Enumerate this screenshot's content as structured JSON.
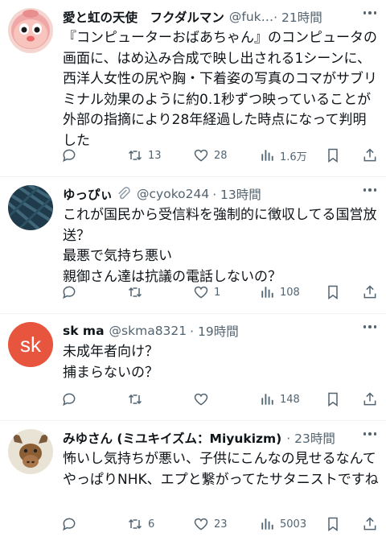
{
  "tweets": [
    {
      "name": "愛と虹の天使　フクダルマン",
      "handle": "@fuk…",
      "time": "· 21時間",
      "text": "『コンピューターおばあちゃん』のコンピュータの画面に、はめ込み合成で映し出される1シーンに、西洋人女性の尻や胸・下着姿の写真のコマがサブリミナル効果のように約0.1秒ずつ映っていることが外部の指摘により28年経過した時点になって判明した",
      "replies": "",
      "retweets": "13",
      "likes": "28",
      "views": "1.6万"
    },
    {
      "name": "ゆっぴぃ",
      "handle": "@cyoko244",
      "time": "· 13時間",
      "text": "これが国民から受信料を強制的に徴収してる国営放送？\n最悪で気持ち悪い\n親御さん達は抗議の電話しないの？",
      "replies": "",
      "retweets": "",
      "likes": "1",
      "views": "108"
    },
    {
      "name": "sk ma",
      "handle": "@skma8321",
      "time": "· 19時間",
      "avatar_letters": "sk",
      "text": "未成年者向け？\n捕まらないの？",
      "replies": "",
      "retweets": "",
      "likes": "",
      "views": "148"
    },
    {
      "name": "みゆさん (ミユキイズム：Miyukizm)",
      "handle": "",
      "time": "· 23時間",
      "text": "怖いし気持ちが悪い、子供にこんなの見せるなんてやっぱりNHK、エプと繋がってたサタニストですね",
      "replies": "",
      "retweets": "6",
      "likes": "23",
      "views": "5003"
    }
  ],
  "colors": {
    "secondary": "#536471",
    "avatar_orange": "#e8553e",
    "divider": "#eff3f4"
  },
  "icons": [
    "reply-icon",
    "retweet-icon",
    "like-icon",
    "views-icon",
    "bookmark-icon",
    "share-icon",
    "more-icon",
    "paperclip-icon"
  ]
}
